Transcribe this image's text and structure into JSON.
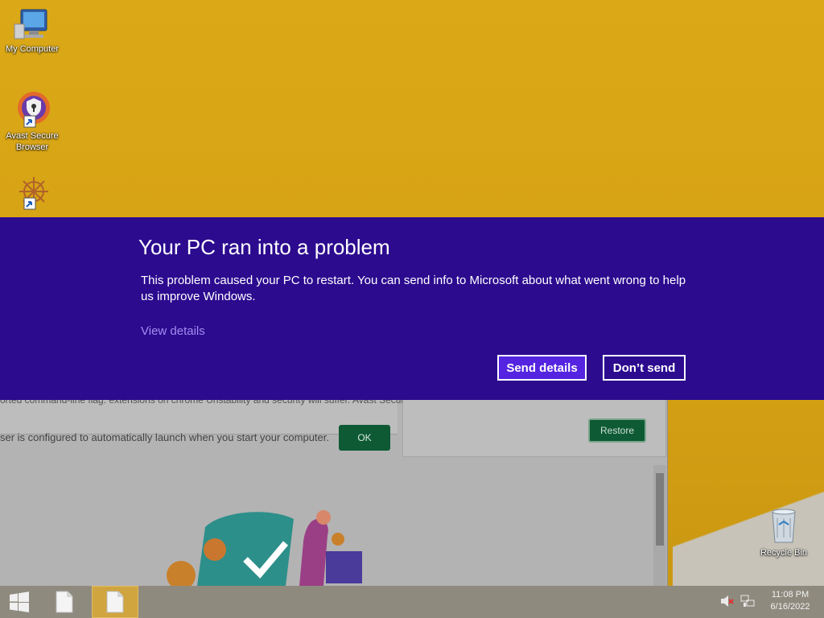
{
  "desktop": {
    "icons": [
      {
        "label": "My Computer"
      },
      {
        "label": "Avast Secure Browser"
      },
      {
        "label": "Recycle Bin"
      }
    ]
  },
  "background_window": {
    "infobar_text": "ser is configured to automatically launch when you start your computer.",
    "partial_text": "orted command-line flag:  extensions on chrome  Unstability and security will suffer.       Avast Secure Browser didn't shut down correctly.",
    "ok_label": "OK",
    "restore_label": "Restore"
  },
  "dialog": {
    "title": "Your PC ran into a problem",
    "body": "This problem caused your PC to restart. You can send info to Microsoft about what went wrong to help us improve Windows.",
    "view_details": "View details",
    "send_details": "Send details",
    "dont_send": "Don’t send"
  },
  "taskbar": {
    "time": "11:08 PM",
    "date": "6/16/2022"
  },
  "colors": {
    "dialog_bg": "#2c0b8f",
    "send_button": "#5524e0",
    "link": "#a48cf0",
    "desktop": "#d6a215",
    "taskbar": "#8f8a7e"
  },
  "icons": [
    "computer-icon",
    "avast-browser-icon",
    "app-shortcut-icon",
    "recycle-bin-icon",
    "windows-start-icon",
    "file-icon",
    "speaker-muted-icon",
    "network-icon"
  ]
}
